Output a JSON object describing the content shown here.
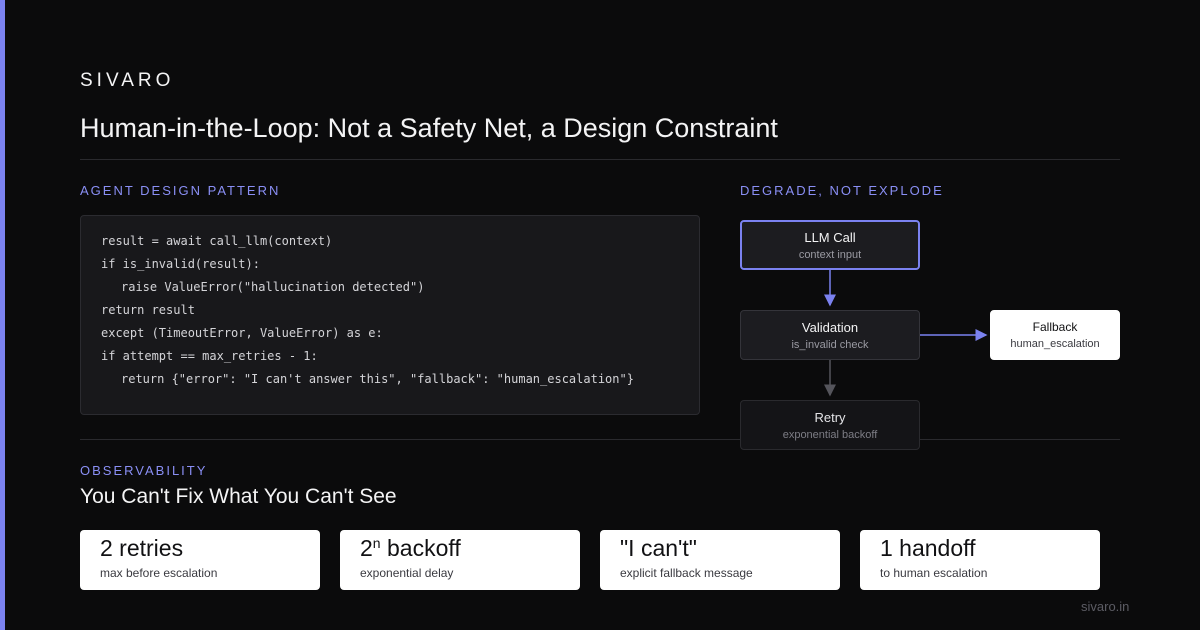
{
  "brand": "SIVARO",
  "title": "Human-in-the-Loop: Not a Safety Net, a Design Constraint",
  "code_section": {
    "label": "AGENT DESIGN PATTERN",
    "lines": [
      "result = await call_llm(context)",
      "if is_invalid(result):",
      "raise ValueError(\"hallucination detected\")",
      "return result",
      "except (TimeoutError, ValueError) as e:",
      "if attempt == max_retries - 1:",
      "return {\"error\": \"I can't answer this\", \"fallback\": \"human_escalation\"}"
    ]
  },
  "flow": {
    "label": "DEGRADE, NOT EXPLODE",
    "nodes": {
      "llm_call": {
        "title": "LLM Call",
        "sub": "context input"
      },
      "validation": {
        "title": "Validation",
        "sub": "is_invalid check"
      },
      "fallback": {
        "title": "Fallback",
        "sub": "human_escalation"
      },
      "retry": {
        "title": "Retry",
        "sub": "exponential backoff"
      }
    }
  },
  "observability": {
    "label": "OBSERVABILITY",
    "heading": "You Can't Fix What You Can't See",
    "stats": [
      {
        "value": "2 retries",
        "caption": "max before escalation"
      },
      {
        "value_base": "2",
        "value_sup": "n",
        "value_rest": " backoff",
        "caption": "exponential delay"
      },
      {
        "value": "\"I can't\"",
        "caption": "explicit fallback message"
      },
      {
        "value": "1 handoff",
        "caption": "to human escalation"
      }
    ]
  },
  "footer": "sivaro.in",
  "colors": {
    "accent": "#7b82f0",
    "background": "#0b0b0c",
    "card": "#ffffff"
  }
}
